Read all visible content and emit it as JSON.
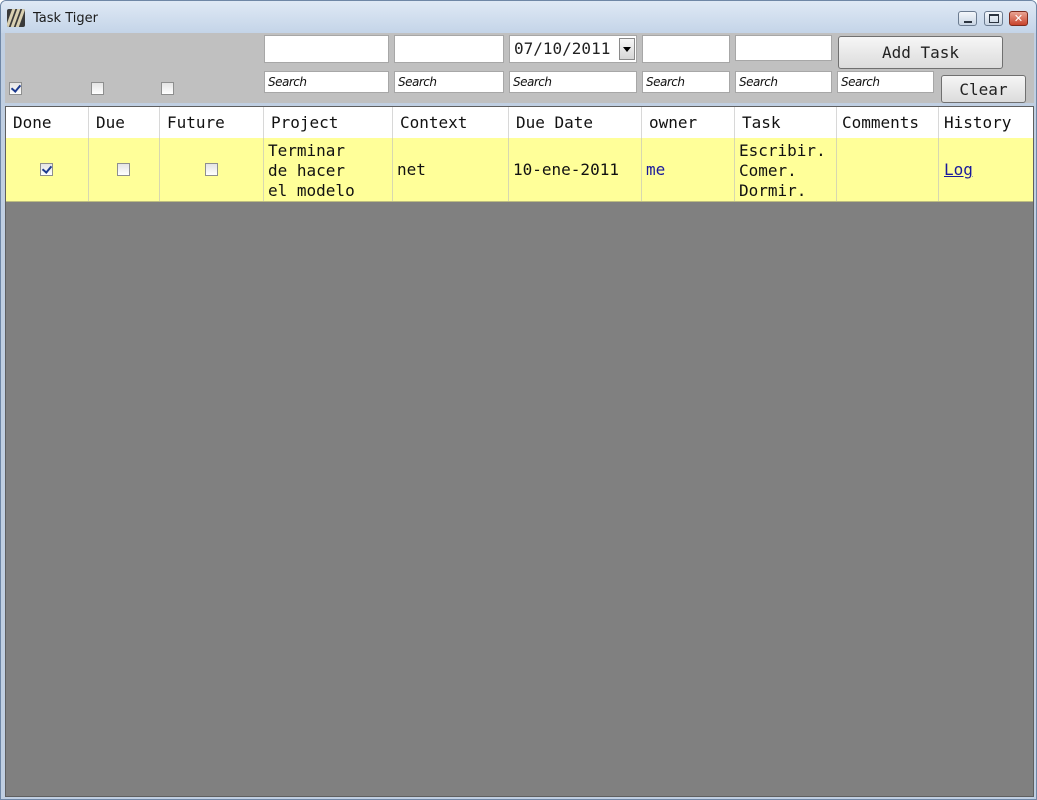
{
  "window": {
    "title": "Task Tiger",
    "icon": "tiger-app-icon"
  },
  "toolbar": {
    "filters": {
      "done_checked": true,
      "due_checked": false,
      "future_checked": false
    },
    "inputs": {
      "project_value": "",
      "context_value": "",
      "due_date_value": "07/10/2011",
      "owner_value": "",
      "task_value": ""
    },
    "search_placeholders": {
      "project": "Search",
      "context": "Search",
      "due_date": "Search",
      "owner": "Search",
      "task": "Search",
      "comments": "Search"
    },
    "add_task_label": "Add Task",
    "clear_label": "Clear"
  },
  "grid": {
    "columns": [
      "Done",
      "Due",
      "Future",
      "Project",
      "Context",
      "Due Date",
      "owner",
      "Task",
      "Comments",
      "History"
    ],
    "rows": [
      {
        "done": true,
        "due": false,
        "future": false,
        "project": "Terminar\nde hacer\nel modelo",
        "context": "net",
        "due_date": "10-ene-2011",
        "owner": "me",
        "task": "Escribir.\nComer.\nDormir.",
        "comments": "",
        "history": "Log"
      }
    ]
  },
  "colors": {
    "row_highlight": "#ffff99",
    "empty_grid": "#808080",
    "toolbar": "#c0c0c0",
    "link": "#1a1a9c"
  }
}
